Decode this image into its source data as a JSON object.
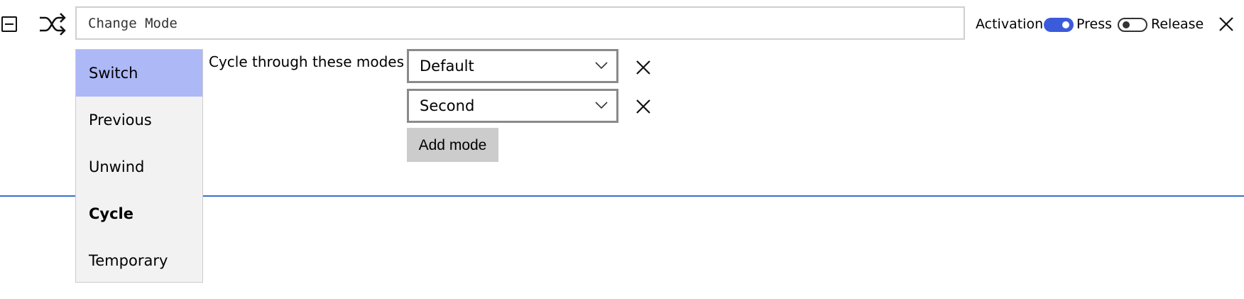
{
  "header": {
    "collapse_icon": "minus-square-icon",
    "type_icon": "shuffle-icon",
    "name_value": "Change Mode",
    "activation_label": "Activation",
    "press_label": "Press",
    "press_on": true,
    "release_label": "Release",
    "release_on": false,
    "close_icon": "close-icon"
  },
  "mode_list": {
    "items": [
      {
        "label": "Switch",
        "selected": true
      },
      {
        "label": "Previous"
      },
      {
        "label": "Unwind"
      },
      {
        "label": "Cycle",
        "bold": true
      },
      {
        "label": "Temporary"
      }
    ]
  },
  "cycle": {
    "label": "Cycle through these modes",
    "modes": [
      {
        "value": "Default"
      },
      {
        "value": "Second"
      }
    ],
    "add_label": "Add mode"
  },
  "colors": {
    "accent": "#3b5bdb",
    "selected_item": "#adb8f7",
    "divider": "#3a6fcf"
  }
}
